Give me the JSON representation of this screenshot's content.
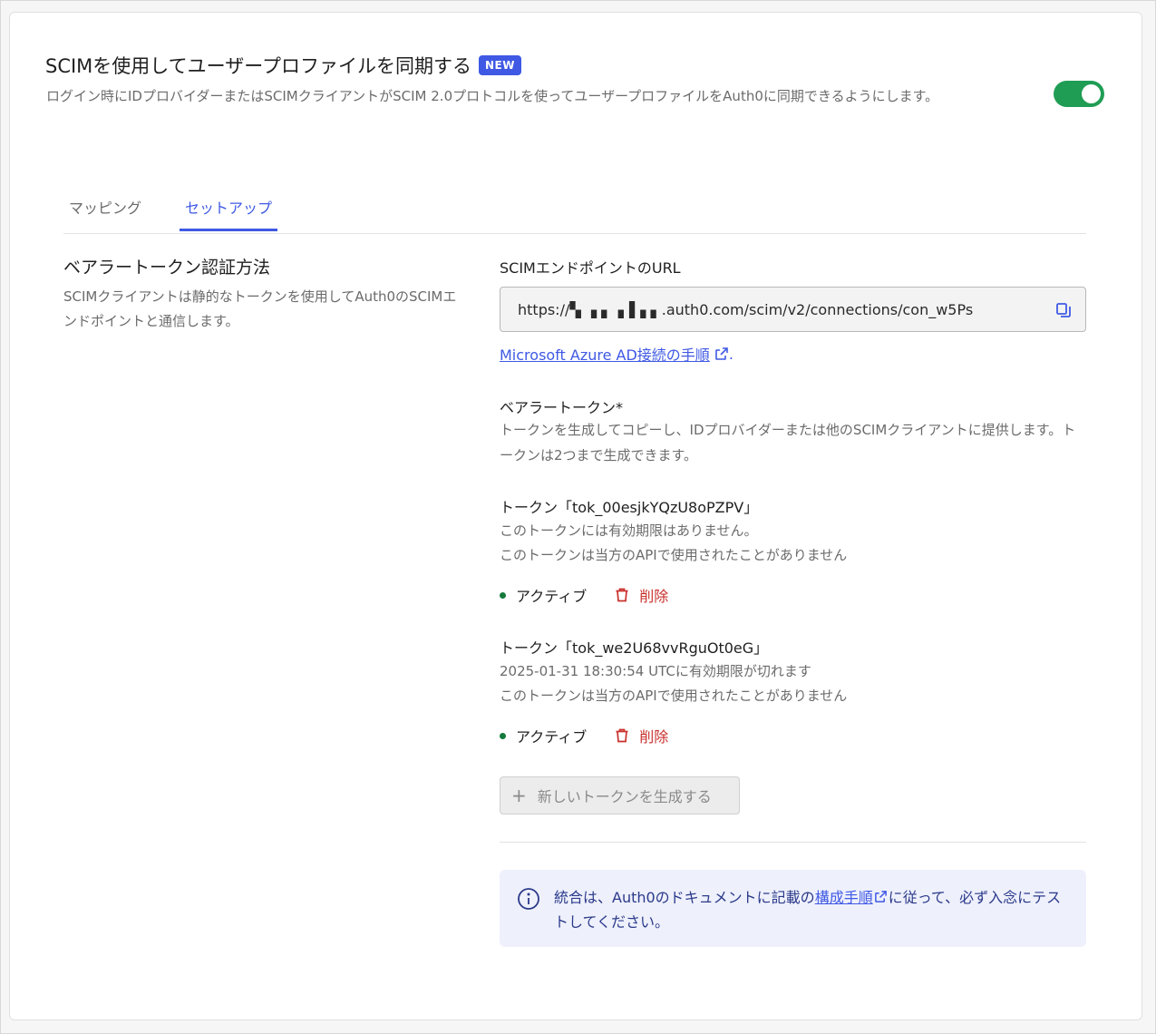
{
  "header": {
    "title": "SCIMを使用してユーザープロファイルを同期する",
    "badge": "NEW",
    "description": "ログイン時にIDプロバイダーまたはSCIMクライアントがSCIM 2.0プロトコルを使ってユーザープロファイルをAuth0に同期できるようにします。",
    "toggle_on": true
  },
  "tabs": [
    {
      "label": "マッピング",
      "active": false
    },
    {
      "label": "セットアップ",
      "active": true
    }
  ],
  "section": {
    "title": "ベアラートークン認証方法",
    "description": "SCIMクライアントは静的なトークンを使用してAuth0のSCIMエンドポイントと通信します。"
  },
  "endpoint": {
    "label": "SCIMエンドポイントのURL",
    "url": "https://▚ ▗ ▖▗▐▗  ▖.auth0.com/scim/v2/connections/con_w5Ps",
    "azure_link": "Microsoft Azure AD接続の手順",
    "azure_suffix": "."
  },
  "bearer": {
    "label": "ベアラートークン*",
    "description": "トークンを生成してコピーし、IDプロバイダーまたは他のSCIMクライアントに提供します。トークンは2つまで生成できます。"
  },
  "tokens": [
    {
      "title": "トークン「tok_00esjkYQzU8oPZPV」",
      "expiry": "このトークンには有効期限はありません。",
      "usage": "このトークンは当方のAPIで使用されたことがありません",
      "status": "アクティブ",
      "delete_label": "削除"
    },
    {
      "title": "トークン「tok_we2U68vvRguOt0eG」",
      "expiry": "2025-01-31 18:30:54 UTCに有効期限が切れます",
      "usage": "このトークンは当方のAPIで使用されたことがありません",
      "status": "アクティブ",
      "delete_label": "削除"
    }
  ],
  "generate_button": {
    "icon": "+",
    "label": "新しいトークンを生成する"
  },
  "info": {
    "prefix": "統合は、Auth0のドキュメントに記載の",
    "link": "構成手順",
    "suffix": "に従って、必ず入念にテストしてください。"
  },
  "colors": {
    "accent": "#3f59e4",
    "toggle_on": "#1f9d55",
    "delete": "#c9302c",
    "status_active": "#137a3b"
  },
  "icons": [
    "copy-icon",
    "external-link-icon",
    "trash-icon",
    "info-icon",
    "plus-icon"
  ]
}
